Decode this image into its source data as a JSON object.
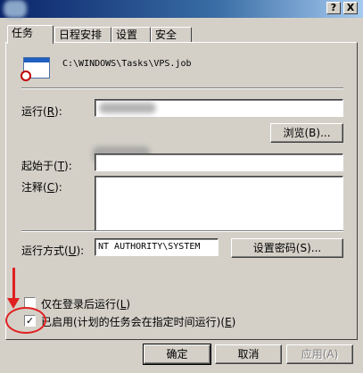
{
  "window": {
    "help_button": "?",
    "close_button": "X"
  },
  "tabs": [
    {
      "label": "任务",
      "active": true
    },
    {
      "label": "日程安排",
      "active": false
    },
    {
      "label": "设置",
      "active": false
    },
    {
      "label": "安全",
      "active": false
    }
  ],
  "task": {
    "path": "C:\\WINDOWS\\Tasks\\VPS.job",
    "run_label": "运行",
    "run_hotkey": "R",
    "browse_button": "浏览(B)...",
    "start_in_label": "起始于",
    "start_in_hotkey": "T",
    "comment_label": "注释",
    "comment_hotkey": "C",
    "run_as_label": "运行方式",
    "run_as_hotkey": "U",
    "run_as_value": "NT AUTHORITY\\SYSTEM",
    "set_password_button": "设置密码(S)...",
    "only_logged_on_label": "仅在登录后运行",
    "only_logged_on_hotkey": "L",
    "only_logged_on_checked": false,
    "enabled_label": "已启用(计划的任务会在指定时间运行)",
    "enabled_hotkey": "E",
    "enabled_checked": true
  },
  "footer": {
    "ok_button": "确定",
    "cancel_button": "取消",
    "apply_button": "应用(A)"
  },
  "colors": {
    "annotation": "#e02020",
    "dialog_face": "#d4d0c8"
  }
}
